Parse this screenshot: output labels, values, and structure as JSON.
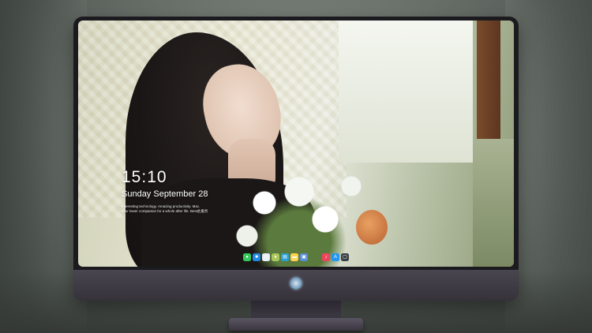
{
  "lock_screen": {
    "time": "15:10",
    "date": "Sunday September 28",
    "caption_line1": "Interesting technology. Amazing productivity. Mac.",
    "caption_line2": "your lower companion for a whole after life. Best此服务"
  },
  "dock": {
    "apps": [
      {
        "name": "messages-icon",
        "glyph": "●",
        "color": "#34c759"
      },
      {
        "name": "finder-icon",
        "glyph": "■",
        "color": "#1e88e5"
      },
      {
        "name": "safari-icon",
        "glyph": "◎",
        "color": "#e8eef5"
      },
      {
        "name": "photos-icon",
        "glyph": "●",
        "color": "#a9c75a"
      },
      {
        "name": "clapper-icon",
        "glyph": "▤",
        "color": "#2a9fd6"
      },
      {
        "name": "notes-icon",
        "glyph": "▬",
        "color": "#ffd34d"
      },
      {
        "name": "preview-icon",
        "glyph": "▣",
        "color": "#5b8fd6"
      },
      {
        "name": "music-icon",
        "glyph": "♪",
        "color": "#f0445e"
      },
      {
        "name": "app-store-icon",
        "glyph": "A",
        "color": "#2196f3"
      },
      {
        "name": "screenshot-icon",
        "glyph": "▢",
        "color": "#3a3f47"
      }
    ]
  },
  "monitor": {
    "logo": "logo-icon"
  }
}
